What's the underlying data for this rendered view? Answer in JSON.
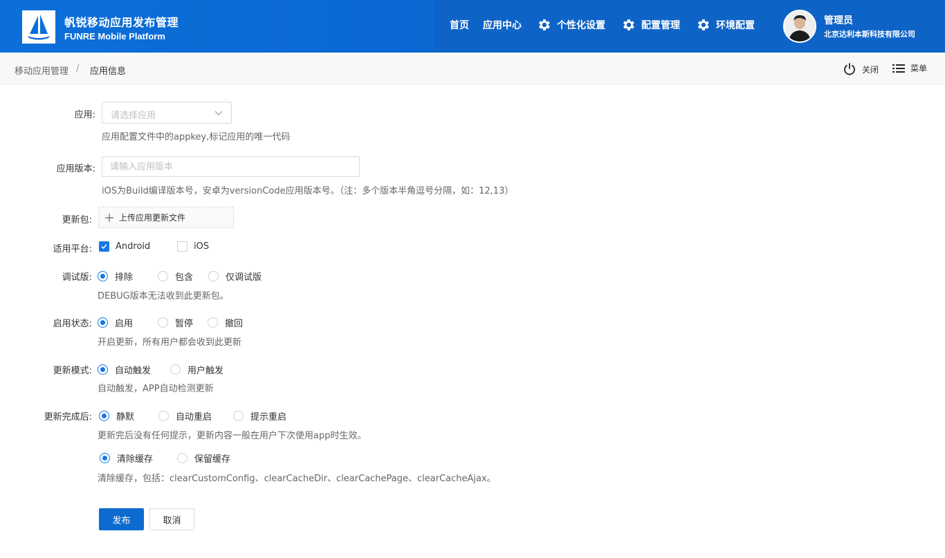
{
  "header": {
    "title": "帆锐移动应用发布管理",
    "subtitle": "FUNRE Mobile Platform",
    "nav": [
      {
        "label": "首页",
        "icon": ""
      },
      {
        "label": "应用中心",
        "icon": ""
      },
      {
        "label": "个性化设置",
        "icon": "gear-icon"
      },
      {
        "label": "配置管理",
        "icon": "gear-icon"
      },
      {
        "label": "环境配置",
        "icon": "gear-icon"
      }
    ],
    "user": {
      "name": "管理员",
      "company": "北京达利本斯科技有限公司"
    }
  },
  "breadcrumb": {
    "items": [
      "移动应用管理",
      "应用信息"
    ],
    "separator": "/"
  },
  "toolbar": {
    "close_label": "关闭",
    "menu_label": "菜单"
  },
  "form": {
    "app": {
      "label": "应用:",
      "placeholder": "请选择应用",
      "help": "应用配置文件中的appkey,标记应用的唯一代码"
    },
    "version": {
      "label": "应用版本:",
      "placeholder": "请输入应用版本",
      "help": "iOS为Build编译版本号，安卓为versionCode应用版本号。（注：多个版本半角逗号分隔，如：12,13）"
    },
    "package": {
      "label": "更新包:",
      "button": "上传应用更新文件"
    },
    "platform": {
      "label": "适用平台:",
      "options": [
        {
          "label": "Android",
          "checked": true
        },
        {
          "label": "iOS",
          "checked": false
        }
      ]
    },
    "debug": {
      "label": "调试版:",
      "options": [
        "排除",
        "包含",
        "仅调试版"
      ],
      "selected": "排除",
      "help": "DEBUG版本无法收到此更新包。"
    },
    "status": {
      "label": "启用状态:",
      "options": [
        "启用",
        "暂停",
        "撤回"
      ],
      "selected": "启用",
      "help": "开启更新，所有用户都会收到此更新"
    },
    "mode": {
      "label": "更新模式:",
      "options": [
        "自动触发",
        "用户触发"
      ],
      "selected": "自动触发",
      "help": "自动触发，APP自动检测更新"
    },
    "after": {
      "label": "更新完成后:",
      "options": [
        "静默",
        "自动重启",
        "提示重启"
      ],
      "selected": "静默",
      "help": "更新完后没有任何提示，更新内容一般在用户下次使用app时生效。"
    },
    "cache": {
      "options": [
        "清除缓存",
        "保留缓存"
      ],
      "selected": "清除缓存",
      "help": "清除缓存，包括：clearCustomConfig、clearCacheDir、clearCachePage、clearCacheAjax。"
    },
    "submit_label": "发布",
    "cancel_label": "取消"
  },
  "colors": {
    "primary": "#0d6bd0",
    "header": "#0c6fd9",
    "accent": "#1677e6"
  }
}
